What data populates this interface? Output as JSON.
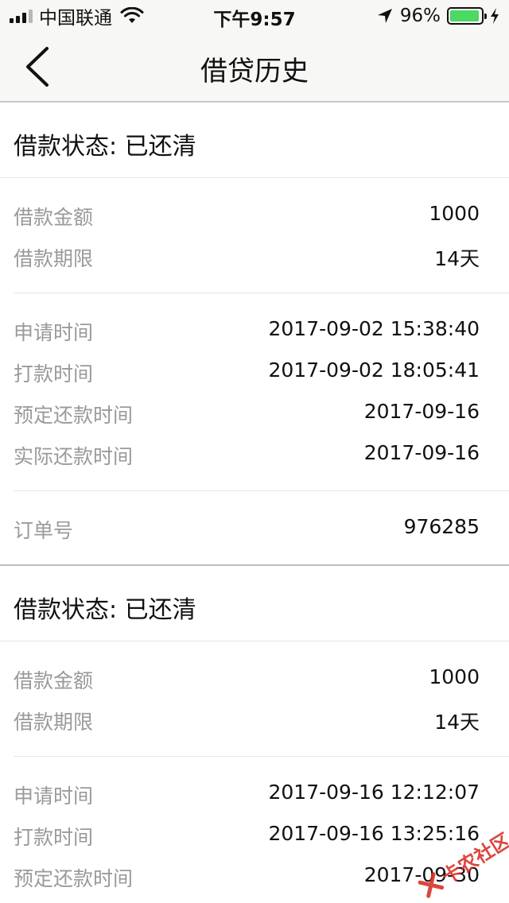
{
  "status_bar": {
    "carrier": "中国联通",
    "time": "下午9:57",
    "battery_percent": "96%",
    "battery_level": 0.96,
    "icons": [
      "signal-icon",
      "wifi-icon",
      "location-arrow-icon",
      "battery-icon",
      "charging-bolt-icon"
    ],
    "battery_color": "#4cd964"
  },
  "nav": {
    "back_icon": "chevron-left-icon",
    "title": "借贷历史"
  },
  "records": [
    {
      "status": "借款状态: 已还清",
      "groups": [
        [
          {
            "label": "借款金额",
            "value": "1000"
          },
          {
            "label": "借款期限",
            "value": "14天"
          }
        ],
        [
          {
            "label": "申请时间",
            "value": "2017-09-02 15:38:40"
          },
          {
            "label": "打款时间",
            "value": "2017-09-02 18:05:41"
          },
          {
            "label": "预定还款时间",
            "value": "2017-09-16"
          },
          {
            "label": "实际还款时间",
            "value": "2017-09-16"
          }
        ],
        [
          {
            "label": "订单号",
            "value": "976285"
          }
        ]
      ]
    },
    {
      "status": "借款状态: 已还清",
      "groups": [
        [
          {
            "label": "借款金额",
            "value": "1000"
          },
          {
            "label": "借款期限",
            "value": "14天"
          }
        ],
        [
          {
            "label": "申请时间",
            "value": "2017-09-16 12:12:07"
          },
          {
            "label": "打款时间",
            "value": "2017-09-16 13:25:16"
          },
          {
            "label": "预定还款时间",
            "value": "2017-09-30"
          }
        ]
      ]
    }
  ],
  "watermark": {
    "text": "卡农社区",
    "color": "#d8322b"
  }
}
